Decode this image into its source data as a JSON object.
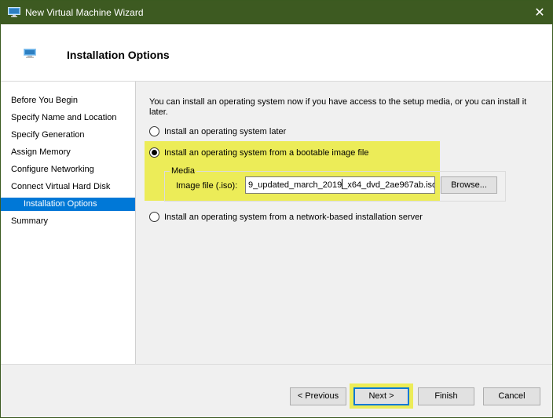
{
  "window": {
    "title": "New Virtual Machine Wizard",
    "close_glyph": "✕",
    "titlebar_color": "#3d5a21",
    "app_icon": "hyperv-monitor-icon"
  },
  "header": {
    "page_title": "Installation Options",
    "icon": "hyperv-monitor-icon"
  },
  "nav": {
    "items": [
      {
        "label": "Before You Begin",
        "selected": false
      },
      {
        "label": "Specify Name and Location",
        "selected": false
      },
      {
        "label": "Specify Generation",
        "selected": false
      },
      {
        "label": "Assign Memory",
        "selected": false
      },
      {
        "label": "Configure Networking",
        "selected": false
      },
      {
        "label": "Connect Virtual Hard Disk",
        "selected": false
      },
      {
        "label": "Installation Options",
        "selected": true
      },
      {
        "label": "Summary",
        "selected": false
      }
    ],
    "selected_color": "#0078d7"
  },
  "content": {
    "intro_text": "You can install an operating system now if you have access to the setup media, or you can install it later.",
    "options": [
      {
        "label": "Install an operating system later",
        "checked": false
      },
      {
        "label": "Install an operating system from a bootable image file",
        "checked": true
      },
      {
        "label": "Install an operating system from a network-based installation server",
        "checked": false
      }
    ],
    "media": {
      "legend": "Media",
      "image_file_label": "Image file (.iso):",
      "image_file_value_before_caret": "9_updated_march_2019",
      "image_file_value_after_caret": "_x64_dvd_2ae967ab.iso",
      "browse_label": "Browse..."
    }
  },
  "highlight_color": "#ecec58",
  "footer": {
    "previous_label": "< Previous",
    "next_label": "Next >",
    "finish_label": "Finish",
    "cancel_label": "Cancel"
  }
}
